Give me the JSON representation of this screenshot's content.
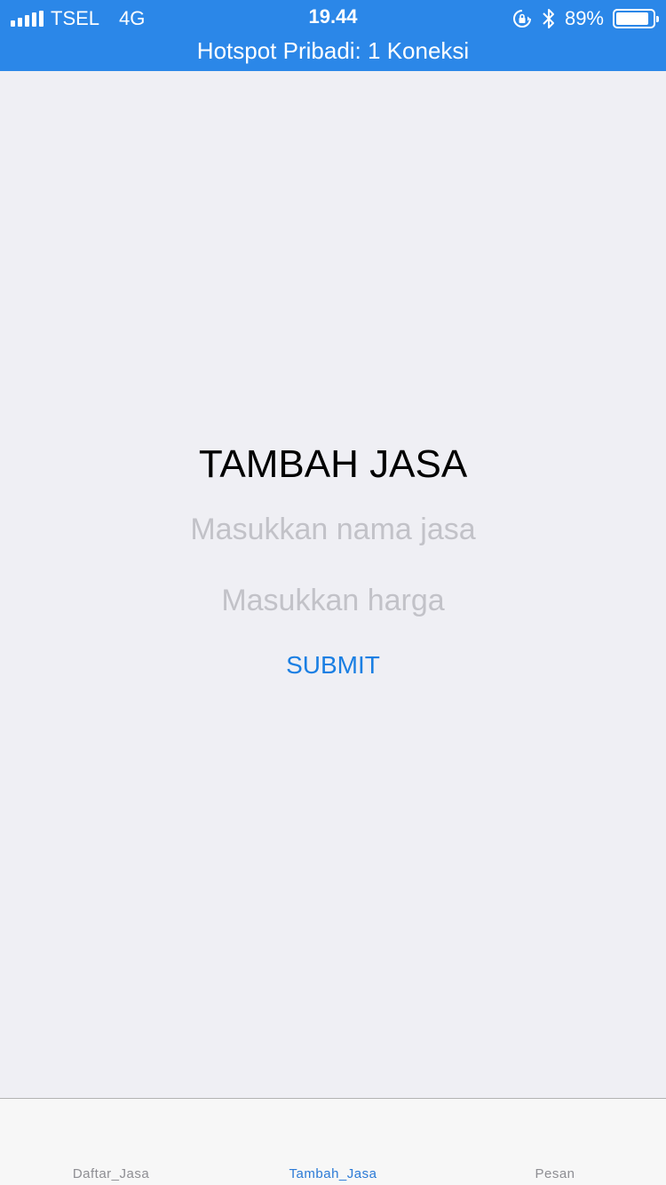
{
  "status_bar": {
    "carrier": "TSEL",
    "network": "4G",
    "time": "19.44",
    "battery": "89%",
    "battery_level": 0.89,
    "hotspot": "Hotspot Pribadi: 1 Koneksi",
    "bg_color": "#2b87e8"
  },
  "form": {
    "title": "TAMBAH JASA",
    "name_placeholder": "Masukkan nama jasa",
    "price_placeholder": "Masukkan harga",
    "submit_label": "SUBMIT"
  },
  "tabs": [
    {
      "label": "Daftar_Jasa",
      "active": false
    },
    {
      "label": "Tambah_Jasa",
      "active": true
    },
    {
      "label": "Pesan",
      "active": false
    }
  ],
  "colors": {
    "accent": "#1a7fe3",
    "background": "#efeff4",
    "placeholder": "#c2c2c8"
  }
}
